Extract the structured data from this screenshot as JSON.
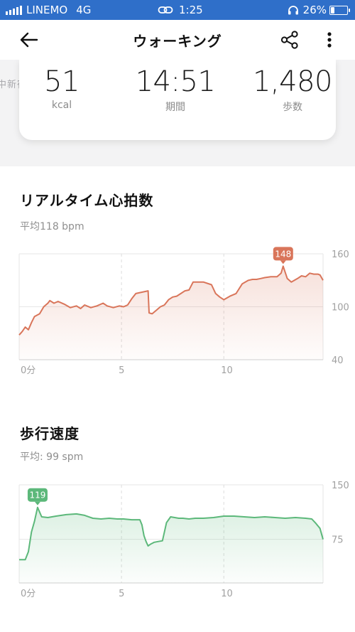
{
  "status_bar": {
    "carrier": "LINEMO",
    "network": "4G",
    "time": "1:25",
    "battery_pct": "26%",
    "battery_level": 0.26
  },
  "header": {
    "title": "ウォーキング",
    "icons": [
      "back-arrow-icon",
      "share-icon",
      "more-vertical-icon"
    ]
  },
  "background_hint": "中新宿",
  "summary": [
    {
      "value": "51",
      "label": "kcal"
    },
    {
      "value": "14:51",
      "label": "期間"
    },
    {
      "value": "1,480",
      "label": "歩数"
    }
  ],
  "heart_rate": {
    "title": "リアルタイム心拍数",
    "subtitle": "平均118  bpm",
    "color": "#d9755a"
  },
  "cadence": {
    "title": "歩行速度",
    "subtitle": "平均: 99 spm",
    "color": "#5cb87a"
  },
  "chart_data": [
    {
      "type": "area",
      "x_ticks": [
        "0分",
        "5",
        "10"
      ],
      "y_ticks": [
        "160",
        "100",
        "40"
      ],
      "ylim": [
        40,
        160
      ],
      "xlim": [
        0,
        14.85
      ],
      "grid": true,
      "peak_label": "148",
      "peak_x": 12.9,
      "x": [
        0,
        0.15,
        0.3,
        0.45,
        0.6,
        0.75,
        1.0,
        1.2,
        1.4,
        1.5,
        1.7,
        1.9,
        2.2,
        2.5,
        2.8,
        3.0,
        3.2,
        3.5,
        3.8,
        4.1,
        4.3,
        4.6,
        4.9,
        5.1,
        5.3,
        5.5,
        5.7,
        5.9,
        6.1,
        6.3,
        6.35,
        6.5,
        6.7,
        6.9,
        7.1,
        7.3,
        7.5,
        7.7,
        7.9,
        8.1,
        8.3,
        8.5,
        9.0,
        9.4,
        9.6,
        9.8,
        10.0,
        10.3,
        10.6,
        10.9,
        11.2,
        11.4,
        11.6,
        11.8,
        12.0,
        12.3,
        12.6,
        12.8,
        12.9,
        13.1,
        13.3,
        13.6,
        13.8,
        14.0,
        14.2,
        14.4,
        14.6,
        14.7,
        14.85
      ],
      "y": [
        68,
        72,
        77,
        74,
        82,
        89,
        92,
        100,
        104,
        107,
        104,
        106,
        103,
        99,
        101,
        98,
        102,
        99,
        101,
        104,
        101,
        99,
        101,
        100,
        102,
        109,
        115,
        116,
        117,
        118,
        93,
        92,
        96,
        100,
        102,
        108,
        111,
        112,
        115,
        118,
        119,
        128,
        128,
        125,
        115,
        111,
        108,
        112,
        115,
        126,
        130,
        131,
        131,
        132,
        133,
        134,
        134,
        138,
        146,
        132,
        128,
        132,
        135,
        134,
        138,
        137,
        137,
        136,
        130
      ]
    },
    {
      "type": "area",
      "x_ticks": [
        "0分",
        "5",
        "10"
      ],
      "y_ticks": [
        "150",
        "75"
      ],
      "ylim": [
        15,
        150
      ],
      "xlim": [
        0,
        14.85
      ],
      "grid": true,
      "peak_label": "119",
      "peak_x": 0.9,
      "x": [
        0,
        0.3,
        0.45,
        0.6,
        0.75,
        0.9,
        1.1,
        1.4,
        1.8,
        2.3,
        2.8,
        3.2,
        3.6,
        4.0,
        4.4,
        4.8,
        5.1,
        5.5,
        5.9,
        6.0,
        6.1,
        6.2,
        6.3,
        6.4,
        6.6,
        6.8,
        7.0,
        7.2,
        7.4,
        7.6,
        7.8,
        8.0,
        8.3,
        8.6,
        9.0,
        9.5,
        10.0,
        10.5,
        11.0,
        11.5,
        12.0,
        12.5,
        13.0,
        13.5,
        14.0,
        14.3,
        14.5,
        14.7,
        14.85
      ],
      "y": [
        47,
        47,
        58,
        85,
        100,
        119,
        106,
        105,
        107,
        109,
        110,
        108,
        104,
        103,
        104,
        103,
        103,
        102,
        102,
        95,
        80,
        72,
        66,
        68,
        71,
        72,
        73,
        98,
        106,
        105,
        104,
        104,
        103,
        104,
        104,
        105,
        107,
        107,
        106,
        105,
        106,
        105,
        104,
        105,
        104,
        103,
        97,
        90,
        75
      ]
    }
  ]
}
